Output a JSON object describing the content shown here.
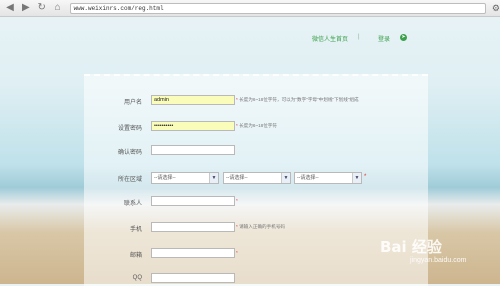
{
  "browser": {
    "back_icon": "arrow-left",
    "forward_icon": "arrow-right",
    "reload_icon": "reload",
    "home_icon": "home",
    "url": "www.weixinrs.com/reg.html"
  },
  "header": {
    "home_link": "微信人生首页",
    "login_link": "登录"
  },
  "form": {
    "username": {
      "label": "用户名",
      "value": "admin",
      "hint": "长度为6~18位字符，可以为\"数字\"字母\"中划线\"下划线\"组成"
    },
    "password": {
      "label": "设置密码",
      "value": "••••••••••",
      "hint": "长度为6~18位字符"
    },
    "confirm_password": {
      "label": "确认密码",
      "value": ""
    },
    "region": {
      "label": "所在区域",
      "province": "--请选择--",
      "city": "--请选择--",
      "district": "--请选择--"
    },
    "contact": {
      "label": "联系人",
      "value": ""
    },
    "phone": {
      "label": "手机",
      "value": "",
      "hint": "请输入正确的手机号码"
    },
    "email": {
      "label": "邮箱",
      "value": ""
    },
    "qq": {
      "label": "QQ",
      "value": ""
    }
  },
  "watermark": {
    "big": "Bai 经验",
    "small": "jingyan.baidu.com"
  }
}
